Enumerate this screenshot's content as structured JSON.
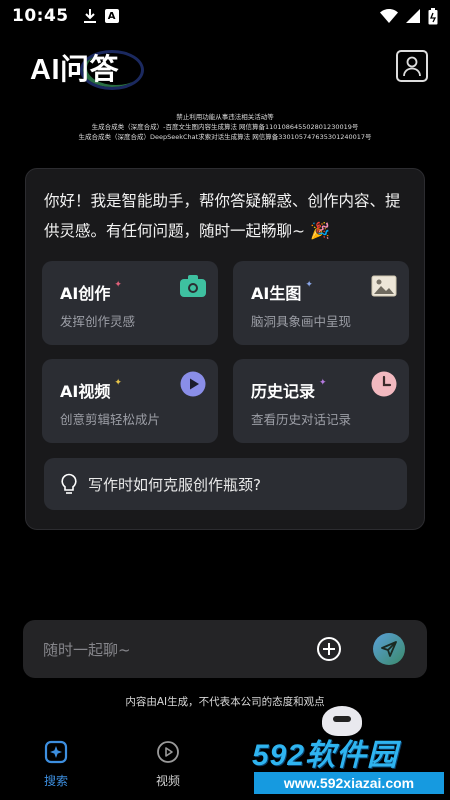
{
  "status_bar": {
    "time": "10:45",
    "left_icons": [
      "download-icon",
      "a-badge-icon"
    ],
    "right_icons": [
      "wifi-icon",
      "signal-icon",
      "battery-icon"
    ]
  },
  "header": {
    "title": "AI问答",
    "user_icon": "user-icon"
  },
  "notice": {
    "line1": "禁止利用功能从事违法相关活动等",
    "line2": "生成合成类（深度合成）-百度文生图内容生成算法 网信算备110108645502801230019号",
    "line3": "生成合成类（深度合成）DeepSeekChat求索对话生成算法 网信算备330105747635301240017号"
  },
  "card": {
    "greeting": "你好！我是智能助手，帮你答疑解惑、创作内容、提供灵感。有任何问题，随时一起畅聊~",
    "greeting_emoji": "🎉",
    "features": [
      {
        "title": "AI创作",
        "subtitle": "发挥创作灵感",
        "icon": "camera-icon",
        "spark_color": "#e0607a"
      },
      {
        "title": "AI生图",
        "subtitle": "脑洞具象画中呈现",
        "icon": "image-icon",
        "spark_color": "#8aa6e8"
      },
      {
        "title": "AI视频",
        "subtitle": "创意剪辑轻松成片",
        "icon": "play-icon",
        "spark_color": "#e8c54a"
      },
      {
        "title": "历史记录",
        "subtitle": "查看历史对话记录",
        "icon": "clock-icon",
        "spark_color": "#b57ae0"
      }
    ],
    "prompt": "写作时如何克服创作瓶颈?"
  },
  "chat_input": {
    "placeholder": "随时一起聊~"
  },
  "disclaimer": "内容由AI生成，不代表本公司的态度和观点",
  "nav": {
    "items": [
      {
        "label": "搜索",
        "icon": "search-sparkle-icon",
        "active": true
      },
      {
        "label": "视频",
        "icon": "video-play-icon",
        "active": false
      }
    ]
  },
  "watermark": {
    "main": "592软件园",
    "url": "www.592xiazai.com"
  },
  "colors": {
    "background": "#000000",
    "card": "#19191b",
    "tile": "#2b2d33",
    "accent_nav": "#3d8fe0"
  }
}
